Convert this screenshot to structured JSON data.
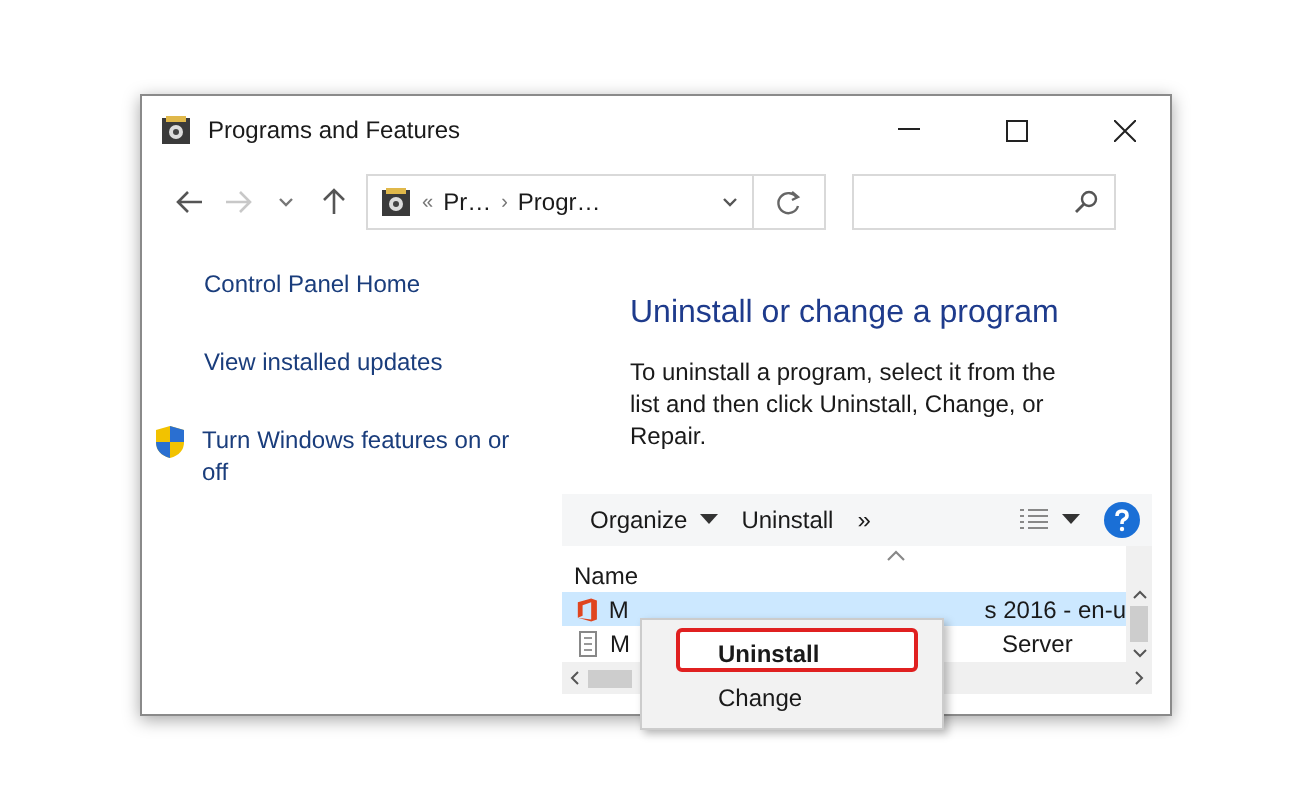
{
  "window": {
    "title": "Programs and Features"
  },
  "address_bar": {
    "overflow": "«",
    "crumbs": [
      "Pr…",
      "Progr…"
    ],
    "separator": "›"
  },
  "sidebar": {
    "items": [
      {
        "label": "Control Panel Home",
        "kind": "link"
      },
      {
        "label": "View installed updates",
        "kind": "link"
      },
      {
        "label": "Turn Windows features on or off",
        "kind": "shield_link"
      }
    ]
  },
  "heading": "Uninstall or change a program",
  "description": "To uninstall a program, select it from the list and then click Uninstall, Change, or Repair.",
  "toolbar": {
    "items": [
      {
        "label": "Organize",
        "kind": "dropdown"
      },
      {
        "label": "Uninstall",
        "kind": "button"
      },
      {
        "label": "»",
        "kind": "button"
      }
    ]
  },
  "table": {
    "columns": [
      {
        "label": "Name",
        "sorted": true
      }
    ],
    "rows": [
      {
        "start": "M",
        "end": "s 2016 - en-u",
        "kind": "office",
        "selected": true
      },
      {
        "start": "M",
        "end": "Server",
        "kind": "generic",
        "selected": false
      }
    ]
  },
  "context_menu": {
    "items": [
      {
        "label": "Uninstall",
        "bold": true,
        "highlighted": true
      },
      {
        "label": "Change",
        "bold": false,
        "highlighted": false
      }
    ]
  }
}
